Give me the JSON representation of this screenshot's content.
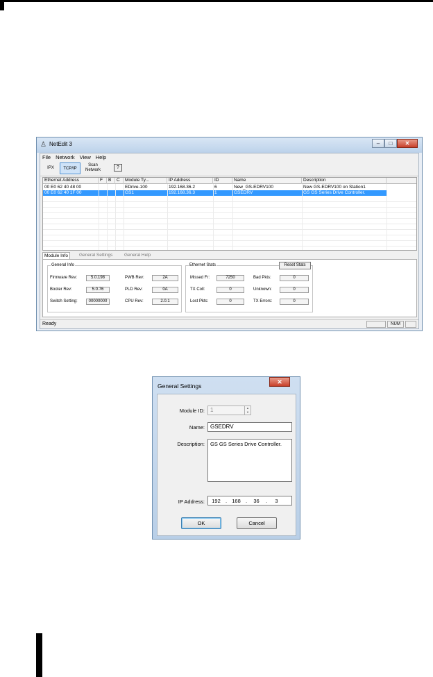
{
  "netedit": {
    "title": "NetEdit 3",
    "window_buttons": {
      "minimize": "–",
      "maximize": "□",
      "close": "✕"
    },
    "menu": [
      "File",
      "Network",
      "View",
      "Help"
    ],
    "toolbar": {
      "ipx": "IPX",
      "tcpip": "TCP/IP",
      "scan_line1": "Scan",
      "scan_line2": "Network",
      "help": "?"
    },
    "grid": {
      "columns": [
        "Ethernet Address",
        "F",
        "B",
        "C",
        "Module Ty...",
        "IP Address",
        "ID",
        "Name",
        "Description"
      ],
      "rows": [
        [
          "00 E0 62 40 48 00",
          "",
          "",
          "",
          "EDrive-100",
          "192.168.36.2",
          "6",
          "New_GS-EDRV100",
          "New GS-EDRV100 on Station1"
        ],
        [
          "00 E0 62 40 1F 00",
          "",
          "",
          "",
          "GS1",
          "192.168.36.3",
          "1",
          "GSEDRV",
          "GS GS Series Drive Controller."
        ]
      ],
      "selected_row": 1
    },
    "tabs": [
      "Module Info",
      "General Settings",
      "General Help"
    ],
    "general_info": {
      "title": "General Info",
      "firmware_rev_label": "Firmware Rev:",
      "firmware_rev": "5.0.198",
      "booter_rev_label": "Booter Rev:",
      "booter_rev": "5.0.76",
      "switch_setting_label": "Switch Setting:",
      "switch_setting": "00000000",
      "pwb_rev_label": "PWB Rev:",
      "pwb_rev": "2A",
      "pld_rev_label": "PLD Rev:",
      "pld_rev": "0A",
      "cpu_rev_label": "CPU Rev:",
      "cpu_rev": "2.0.1"
    },
    "ethernet_stats": {
      "title": "Ethernet Stats",
      "reset_label": "Reset Stats",
      "missed_label": "Missed Fr:",
      "missed": "7250",
      "tx_coll_label": "TX Coll:",
      "tx_coll": "0",
      "lost_label": "Lost Pkts:",
      "lost": "0",
      "bad_label": "Bad Pkts:",
      "bad": "0",
      "unknown_label": "Unknown:",
      "unknown": "0",
      "tx_errors_label": "TX Errors:",
      "tx_errors": "0"
    },
    "status": {
      "text": "Ready",
      "num": "NUM"
    }
  },
  "dialog": {
    "title": "General Settings",
    "close": "✕",
    "module_id_label": "Module ID:",
    "module_id": "1",
    "name_label": "Name:",
    "name": "GSEDRV",
    "description_label": "Description:",
    "description": "GS GS Series Drive Controller.",
    "ip_label": "IP Address:",
    "ip_octets": [
      "192",
      "168",
      "36",
      "3"
    ],
    "ok": "OK",
    "cancel": "Cancel"
  },
  "colors": {
    "selection": "#3399ff",
    "title_gradient_top": "#d9e6f5",
    "close_button": "#c8402a"
  }
}
